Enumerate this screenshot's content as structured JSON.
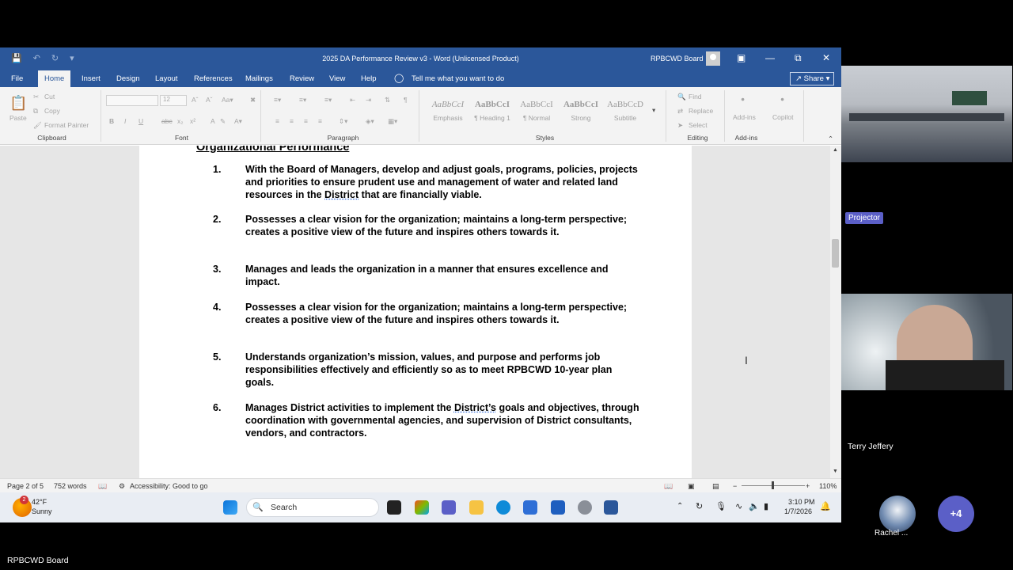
{
  "word": {
    "title": "2025 DA Performance Review v3  -  Word (Unlicensed Product)",
    "account": "RPBCWD Board",
    "tabs": [
      "File",
      "Home",
      "Insert",
      "Design",
      "Layout",
      "References",
      "Mailings",
      "Review",
      "View",
      "Help"
    ],
    "active_tab": "Home",
    "tell_me": "Tell me what you want to do",
    "share": "Share",
    "ribbon": {
      "clipboard": {
        "label": "Clipboard",
        "paste": "Paste",
        "cut": "Cut",
        "copy": "Copy",
        "format_painter": "Format Painter"
      },
      "font": {
        "label": "Font",
        "size": "12"
      },
      "paragraph": {
        "label": "Paragraph"
      },
      "styles": {
        "label": "Styles",
        "items": [
          {
            "sample": "AaBbCcI",
            "name": "Emphasis"
          },
          {
            "sample": "AaBbCcI",
            "name": "¶ Heading 1"
          },
          {
            "sample": "AaBbCcI",
            "name": "¶ Normal"
          },
          {
            "sample": "AaBbCcI",
            "name": "Strong"
          },
          {
            "sample": "AaBbCcD",
            "name": "Subtitle"
          }
        ]
      },
      "editing": {
        "label": "Editing",
        "find": "Find",
        "replace": "Replace",
        "select": "Select"
      },
      "addins": {
        "label": "Add-ins",
        "addins_btn": "Add-ins",
        "copilot": "Copilot"
      }
    },
    "document": {
      "heading": "Organizational Performance",
      "items": [
        {
          "num": "1.",
          "text_before": "With the Board of Managers, develop and adjust goals, programs, policies, projects and priorities to ensure prudent use and management of water and related land resources in the ",
          "flagged": "District",
          "text_after": " that are financially viable."
        },
        {
          "num": "2.",
          "text_before": "Possesses a clear vision for the organization; maintains a long-term perspective; creates a positive view of the future and inspires others towards it.",
          "flagged": "",
          "text_after": ""
        },
        {
          "num": "3.",
          "text_before": "Manages and leads the organization in a manner that ensures excellence and impact.",
          "flagged": "",
          "text_after": ""
        },
        {
          "num": "4.",
          "text_before": "Possesses a clear vision for the organization; maintains a long-term perspective; creates a positive view of the future and inspires others towards it.",
          "flagged": "",
          "text_after": ""
        },
        {
          "num": "5.",
          "text_before": "Understands organization’s mission, values, and purpose and performs job responsibilities effectively and efficiently so as to meet RPBCWD 10-year plan goals.",
          "flagged": "",
          "text_after": ""
        },
        {
          "num": "6.",
          "text_before": "Manages District activities to implement the ",
          "flagged": "District’s",
          "text_after": " goals and objectives, through coordination with governmental agencies, and supervision of District consultants, vendors, and contractors."
        }
      ]
    },
    "status": {
      "page": "Page 2 of 5",
      "words": "752 words",
      "accessibility": "Accessibility: Good to go",
      "zoom": "110%"
    }
  },
  "taskbar": {
    "weather_temp": "42°F",
    "weather_desc": "Sunny",
    "weather_badge": "2",
    "search": "Search",
    "time": "3:10 PM",
    "date": "1/7/2026"
  },
  "meeting": {
    "projector_label": "Projector",
    "participant_1": "Terry Jeffery",
    "participant_2": "Rachel ...",
    "more_count": "+4",
    "room_label": "RPBCWD Board"
  }
}
